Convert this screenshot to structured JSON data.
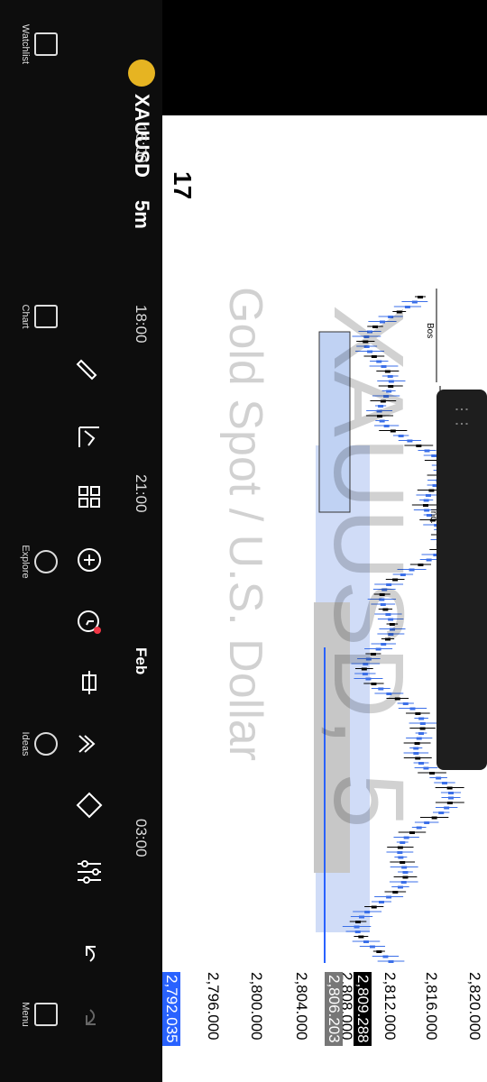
{
  "header": {
    "symbol": "XAUUSD",
    "interval": "5m",
    "watermark_symbol": "XAUUSD, 5",
    "watermark_name": "Gold Spot / U.S. Dollar",
    "logo_text": "17"
  },
  "nav": [
    {
      "label": "Watchlist",
      "icon": "watchlist-icon"
    },
    {
      "label": "Chart",
      "icon": "chart-icon"
    },
    {
      "label": "Explore",
      "icon": "compass-icon"
    },
    {
      "label": "Ideas",
      "icon": "lightbulb-icon"
    },
    {
      "label": "Menu",
      "icon": "menu-icon"
    }
  ],
  "time_labels": [
    "15:00",
    "18:00",
    "21:00",
    "Feb",
    "03:00"
  ],
  "price_labels": [
    "2,820.000",
    "2,816.000",
    "2,812.000",
    "2,809.288",
    "2,808.000",
    "2,806.203",
    "2,804.000",
    "2,800.000",
    "2,796.000",
    "2,792.035"
  ],
  "annotations": {
    "bos": "Bos",
    "ind": "Ind."
  },
  "colors": {
    "up": "#3b6fe8",
    "down": "#000000",
    "zone": "#c8d8f8",
    "zone_gray": "#c0c0c0",
    "price_tag_blue": "#2962ff",
    "price_tag_black": "#000000",
    "price_tag_gray": "#777777"
  },
  "chart_data": {
    "type": "candlestick",
    "x": [
      "15:00",
      "18:00",
      "21:00",
      "Feb",
      "03:00"
    ],
    "y_range": [
      2790,
      2822
    ],
    "last_price": 2792.035
  }
}
